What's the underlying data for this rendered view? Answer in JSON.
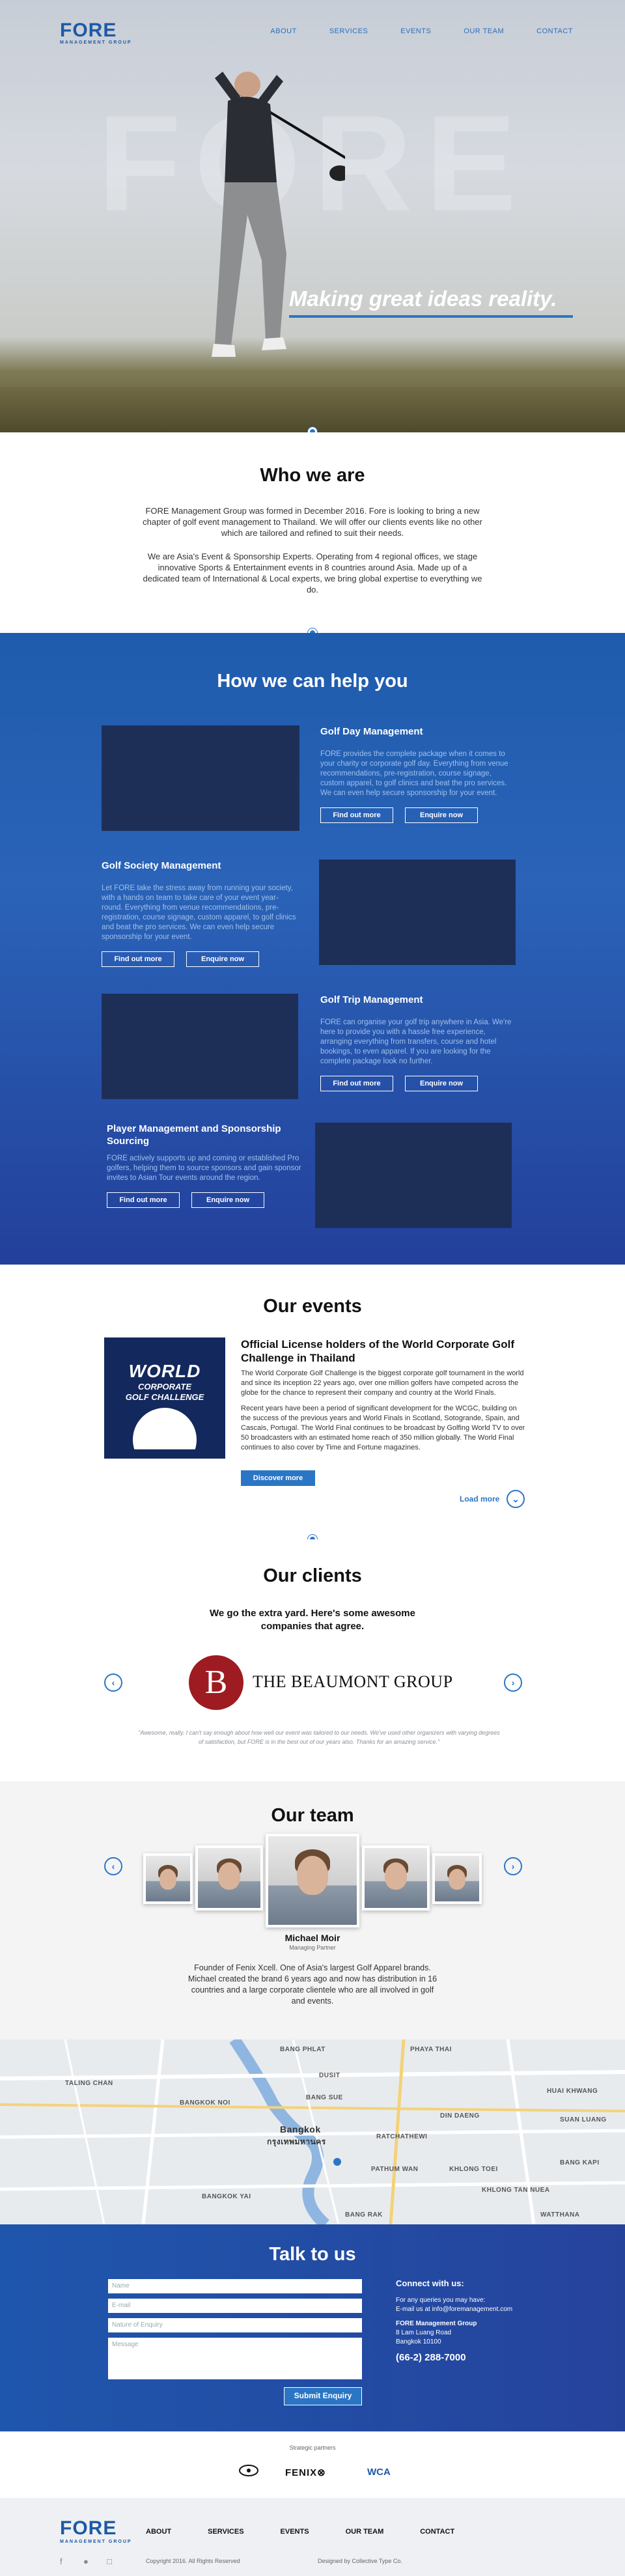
{
  "brand": {
    "logo": "FORE",
    "logo_sub": "MANAGEMENT GROUP"
  },
  "nav": [
    "ABOUT",
    "SERVICES",
    "EVENTS",
    "OUR TEAM",
    "CONTACT"
  ],
  "hero": {
    "ghost_text": "FORE",
    "tagline": "Making great ideas reality."
  },
  "who": {
    "title": "Who we are",
    "p1": "FORE Management Group was formed in December 2016. Fore is looking to bring a new chapter of golf event management to Thailand. We will offer our clients events like no other which are tailored and refined to suit their needs.",
    "p2": "We are Asia's Event & Sponsorship Experts. Operating from 4 regional offices, we stage innovative Sports & Entertainment events in 8 countries around Asia. Made up of a dedicated team of International & Local experts, we bring global expertise to everything we do."
  },
  "help": {
    "title": "How we can help you",
    "find_out_more": "Find out more",
    "enquire_now": "Enquire now",
    "services": [
      {
        "title": "Golf Day Management",
        "text": "FORE provides the complete package when it comes to your charity or corporate golf day. Everything from venue recommendations, pre-registration, course signage, custom apparel, to golf clinics and beat the pro services. We can even help secure sponsorship for your event."
      },
      {
        "title": "Golf Society Management",
        "text": "Let FORE take the stress away from running your society, with a hands on team to take care of your event year-round. Everything from venue recommendations, pre-registration, course signage, custom apparel, to golf clinics and beat the pro services. We can even help secure sponsorship for your event."
      },
      {
        "title": "Golf Trip Management",
        "text": "FORE can organise your golf trip anywhere in Asia. We're here to provide you with a hassle free experience, arranging everything from transfers, course and hotel bookings, to even apparel. If you are looking for the complete package look no further."
      },
      {
        "title": "Player Management and Sponsorship Sourcing",
        "text": "FORE actively supports up and coming or established Pro golfers, helping them to source sponsors and gain sponsor invites to Asian Tour events around the region."
      }
    ]
  },
  "events": {
    "title": "Our events",
    "logo_line1": "WORLD",
    "logo_line2": "CORPORATE",
    "logo_line3": "GOLF CHALLENGE",
    "heading": "Official License holders of the World Corporate Golf Challenge in Thailand",
    "p1": "The World Corporate Golf Challenge is the biggest corporate golf tournament in the world and since its inception 22 years ago, over one million golfers have competed across the globe for the chance to represent their company and country at the World Finals.",
    "p2": "Recent years have been a period of significant development for the WCGC, building on the success of the previous years and World Finals in Scotland, Sotogrande, Spain, and Cascais, Portugal. The World Final continues to be broadcast by Golfing World TV to over 50 broadcasters with an estimated home reach of 350 million globally. The World Final continues to also cover by Time and Fortune magazines.",
    "discover": "Discover more",
    "load_more": "Load more"
  },
  "clients": {
    "title": "Our clients",
    "subtitle": "We go the extra yard. Here's some awesome companies that agree.",
    "client_mark": "B",
    "client_name": "THE BEAUMONT GROUP",
    "quote": "\"Awesome, really. I can't say enough about how well our event was tailored to our needs. We've used other organizers with varying degrees of satisfaction, but FORE is in the best out of our years also. Thanks for an amazing service.\""
  },
  "team": {
    "title": "Our team",
    "name": "Michael Moir",
    "role": "Managing Partner",
    "bio": "Founder of Fenix Xcell. One of Asia's largest Golf Apparel brands. Michael created the brand 6 years ago and now has distribution in 16 countries and a large corporate clientele who are all involved in golf and events."
  },
  "map": {
    "labels": [
      "BANG PHLAT",
      "PHAYA THAI",
      "TALING CHAN",
      "DUSIT",
      "HUAI KHWANG",
      "BANGKOK NOI",
      "BANG SUE",
      "DIN DAENG",
      "RATCHATHEWI",
      "Bangkok",
      "กรุงเทพมหานคร",
      "PATHUM WAN",
      "KHLONG TOEI",
      "BANG KAPI",
      "BANGKOK YAI",
      "BANG RAK",
      "WATTHANA",
      "KHLONG TAN NUEA",
      "SUAN LUANG"
    ]
  },
  "contact": {
    "title": "Talk to us",
    "name_ph": "Name",
    "email_ph": "E-mail",
    "nature_ph": "Nature of Enquiry",
    "message_ph": "Message",
    "submit": "Submit Enquiry",
    "connect": "Connect with us:",
    "enquiry_line": "For any queries you may have:",
    "email_line": "E-mail us at info@foremanagement.com",
    "company": "FORE Management Group",
    "addr1": "8 Lam Luang Road",
    "addr2": "Bangkok 10100",
    "phone": "(66-2) 288-7000"
  },
  "partners": {
    "label": "Strategic partners",
    "logos": [
      "FENIX⊗",
      "WCA"
    ]
  },
  "footer": {
    "links": [
      "ABOUT",
      "SERVICES",
      "EVENTS",
      "OUR TEAM",
      "CONTACT"
    ],
    "copyright": "Copyright 2016. All Rights Reserved",
    "designer": "Designed by Collective Type Co."
  },
  "colors": {
    "accent": "#2b76c4",
    "navy": "#23409b",
    "dark_panel": "#1e2f57"
  },
  "icons": [
    "facebook-icon",
    "twitter-icon",
    "instagram-icon",
    "chevron-left-icon",
    "chevron-right-icon",
    "chevron-down-icon"
  ]
}
